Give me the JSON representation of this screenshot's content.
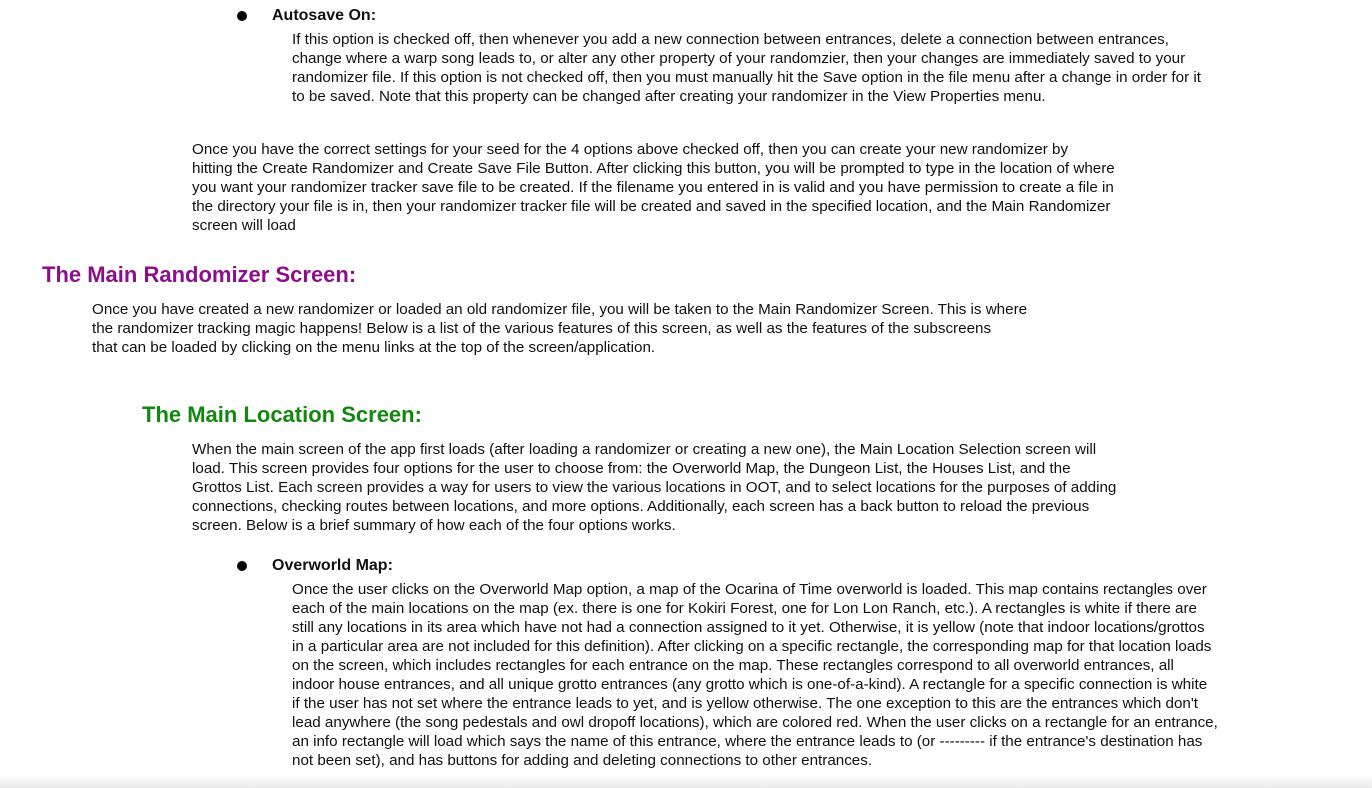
{
  "colors": {
    "heading_primary": "#8b0f8b",
    "heading_secondary": "#13870f",
    "text": "#111111"
  },
  "autosave": {
    "title": "Autosave On:",
    "lines": [
      "If this option is checked off, then whenever you add a new connection between entrances, delete a connection between entrances,",
      "change where a warp song leads to, or alter any other property of your randomzier, then your changes are immediately saved to your",
      "randomizer file. If this option is not checked off, then you must manually hit the Save option in the file menu after a change in order for it",
      "to be saved. Note that this property can be changed after creating your randomizer in the View Properties menu."
    ]
  },
  "create_paragraph": {
    "lines": [
      "Once you have the correct settings for your seed for the 4 options above checked off, then you can create your new randomizer by",
      "hitting the Create Randomizer and Create Save File Button. After clicking this button, you will be prompted to type in the location of where",
      "you want your randomizer tracker save file to be created. If the filename you entered in is valid and you have permission to create a file in",
      "the directory your file is in, then your randomizer tracker file will be created and saved in the specified location, and the Main Randomizer",
      "screen will load"
    ]
  },
  "main_screen": {
    "heading": "The Main Randomizer Screen:",
    "lines": [
      "Once you have created a new randomizer or loaded an old randomizer file, you will be taken to the Main Randomizer Screen. This is where",
      "the randomizer tracking magic happens! Below is a list of the various features of this screen, as well as the features of the subscreens",
      "that can be loaded by clicking on the menu links at the top of the screen/application."
    ]
  },
  "location_screen": {
    "heading": "The Main Location Screen:",
    "lines": [
      "When the main screen of the app first loads (after loading a randomizer or creating a new one), the Main Location Selection screen will",
      "load. This screen provides four options for the user to choose from: the Overworld Map, the Dungeon List, the Houses List, and the",
      "Grottos List. Each screen provides a way for users to view the various locations in OOT, and to select locations for the purposes of adding",
      "connections, checking routes between locations, and more options. Additionally, each screen has a back button to reload the previous",
      "screen. Below is a brief summary of how each of the four options works."
    ]
  },
  "overworld": {
    "title": "Overworld Map:",
    "lines": [
      "Once the user clicks on the Overworld Map option, a map of the Ocarina of Time overworld is loaded. This map contains rectangles over",
      "each of the main locations on the map (ex. there is one for Kokiri Forest, one for Lon Lon Ranch, etc.). A rectangles is white if there are",
      "still any locations in its area which have not had a connection assigned to it yet. Otherwise, it is yellow (note that indoor locations/grottos",
      "in a particular area are not included for this definition). After clicking on a specific rectangle, the corresponding map for that location loads",
      "on the screen, which includes rectangles for each entrance on the map. These rectangles correspond to all overworld entrances, all",
      "indoor house entrances, and all unique grotto entrances (any grotto which is one-of-a-kind). A rectangle for a specific connection is white",
      "if the user has not set where the entrance leads to yet, and is yellow otherwise. The one exception to this are the entrances which don't",
      "lead anywhere (the song pedestals and owl dropoff locations), which are colored red. When the user clicks on a rectangle for an entrance,",
      "an info rectangle will load which says the name of this entrance, where the entrance leads to (or --------- if the entrance's destination has",
      "not been set), and has buttons for adding and deleting connections to other entrances."
    ]
  }
}
